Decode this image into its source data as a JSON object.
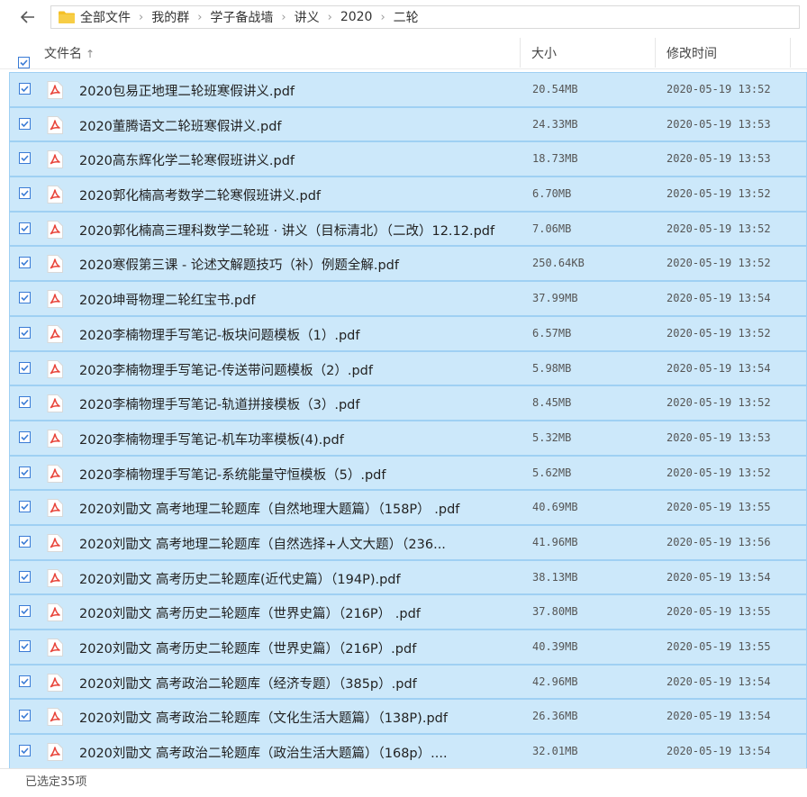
{
  "breadcrumb": {
    "crumbs": [
      "全部文件",
      "我的群",
      "学子备战墙",
      "讲义",
      "2020",
      "二轮"
    ],
    "separator": "›"
  },
  "header": {
    "name_label": "文件名",
    "sort_arrow": "↑",
    "size_label": "大小",
    "time_label": "修改时间"
  },
  "files": [
    {
      "name": "2020包易正地理二轮班寒假讲义.pdf",
      "size": "20.54MB",
      "time": "2020-05-19 13:52"
    },
    {
      "name": "2020董腾语文二轮班寒假讲义.pdf",
      "size": "24.33MB",
      "time": "2020-05-19 13:53"
    },
    {
      "name": "2020高东辉化学二轮寒假班讲义.pdf",
      "size": "18.73MB",
      "time": "2020-05-19 13:53"
    },
    {
      "name": "2020郭化楠高考数学二轮寒假班讲义.pdf",
      "size": "6.70MB",
      "time": "2020-05-19 13:52"
    },
    {
      "name": "2020郭化楠高三理科数学二轮班 · 讲义（目标清北）（二改）12.12.pdf",
      "size": "7.06MB",
      "time": "2020-05-19 13:52"
    },
    {
      "name": "2020寒假第三课 - 论述文解题技巧（补）例题全解.pdf",
      "size": "250.64KB",
      "time": "2020-05-19 13:52"
    },
    {
      "name": "2020坤哥物理二轮红宝书.pdf",
      "size": "37.99MB",
      "time": "2020-05-19 13:54"
    },
    {
      "name": "2020李楠物理手写笔记-板块问题模板（1）.pdf",
      "size": "6.57MB",
      "time": "2020-05-19 13:52"
    },
    {
      "name": "2020李楠物理手写笔记-传送带问题模板（2）.pdf",
      "size": "5.98MB",
      "time": "2020-05-19 13:54"
    },
    {
      "name": "2020李楠物理手写笔记-轨道拼接模板（3）.pdf",
      "size": "8.45MB",
      "time": "2020-05-19 13:52"
    },
    {
      "name": "2020李楠物理手写笔记-机车功率模板(4).pdf",
      "size": "5.32MB",
      "time": "2020-05-19 13:53"
    },
    {
      "name": "2020李楠物理手写笔记-系统能量守恒模板（5）.pdf",
      "size": "5.62MB",
      "time": "2020-05-19 13:52"
    },
    {
      "name": "2020刘勖文 高考地理二轮题库（自然地理大题篇）（158P） .pdf",
      "size": "40.69MB",
      "time": "2020-05-19 13:55"
    },
    {
      "name": "2020刘勖文 高考地理二轮题库（自然选择+人文大题）（236...",
      "size": "41.96MB",
      "time": "2020-05-19 13:56"
    },
    {
      "name": "2020刘勖文 高考历史二轮题库(近代史篇）（194P).pdf",
      "size": "38.13MB",
      "time": "2020-05-19 13:54"
    },
    {
      "name": "2020刘勖文 高考历史二轮题库（世界史篇）（216P） .pdf",
      "size": "37.80MB",
      "time": "2020-05-19 13:55"
    },
    {
      "name": "2020刘勖文 高考历史二轮题库（世界史篇）（216P）.pdf",
      "size": "40.39MB",
      "time": "2020-05-19 13:55"
    },
    {
      "name": "2020刘勖文 高考政治二轮题库（经济专题）（385p）.pdf",
      "size": "42.96MB",
      "time": "2020-05-19 13:54"
    },
    {
      "name": "2020刘勖文 高考政治二轮题库（文化生活大题篇）（138P).pdf",
      "size": "26.36MB",
      "time": "2020-05-19 13:54"
    },
    {
      "name": "2020刘勖文 高考政治二轮题库（政治生活大题篇）（168p）....",
      "size": "32.01MB",
      "time": "2020-05-19 13:54"
    }
  ],
  "status": {
    "selected_text": "已选定35项"
  },
  "colors": {
    "row_bg": "#cce8fa",
    "row_border": "#9fd0f3",
    "check_blue": "#3a7bd5",
    "pdf_red": "#e8443a",
    "folder_yellow": "#f5c026"
  },
  "icons": {
    "back": "arrow-left-icon",
    "folder": "folder-icon",
    "file": "pdf-icon",
    "check": "checkbox-icon"
  }
}
